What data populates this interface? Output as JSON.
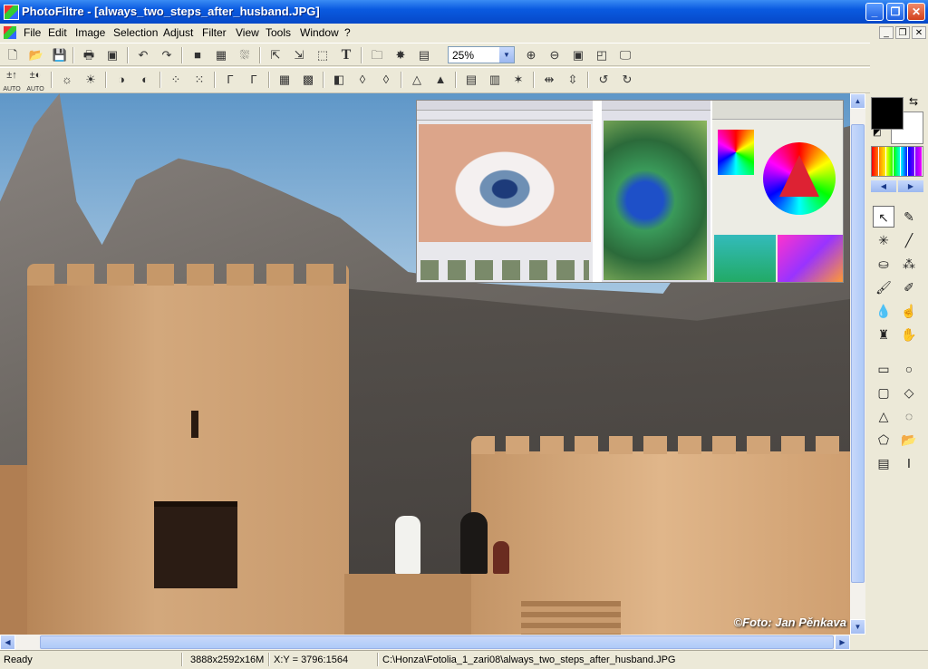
{
  "window": {
    "title": "PhotoFiltre - [always_two_steps_after_husband.JPG]"
  },
  "menu": [
    "File",
    "Edit",
    "Image",
    "Selection",
    "Adjust",
    "Filter",
    "View",
    "Tools",
    "Window",
    "?"
  ],
  "toolbar": {
    "zoom": "25%"
  },
  "toolbar2": {
    "auto_label_1": "AUTO",
    "auto_label_2": "AUTO"
  },
  "image": {
    "watermark": "©Foto: Jan Pěnkava"
  },
  "status": {
    "state": "Ready",
    "image_info": "3888x2592x16M",
    "coords": "X:Y = 3796:1564",
    "path": "C:\\Honza\\Fotolia_1_zari08\\always_two_steps_after_husband.JPG"
  }
}
